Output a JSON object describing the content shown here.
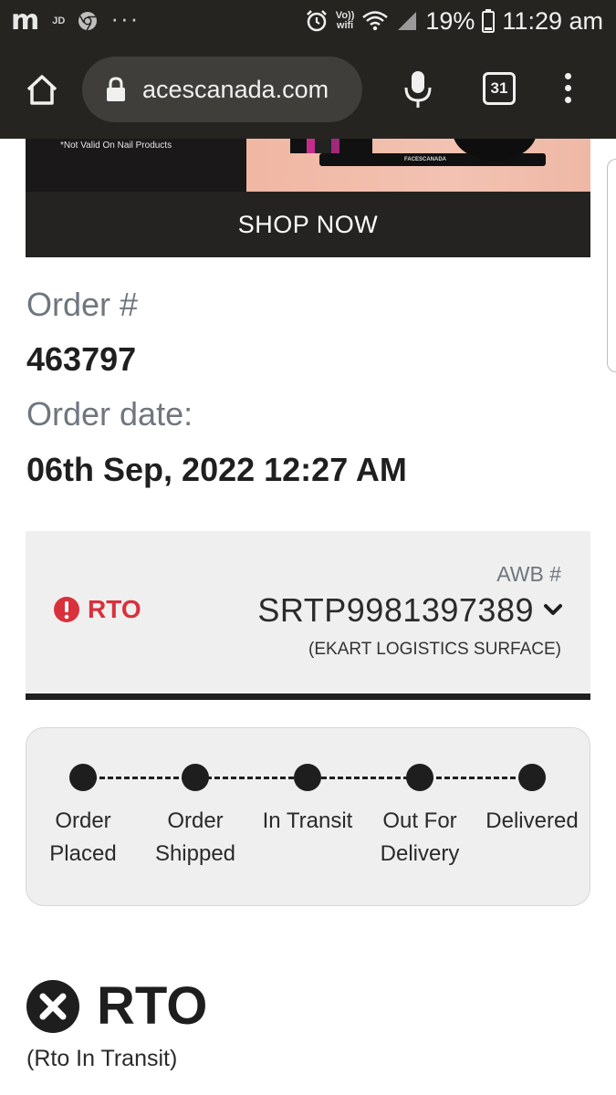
{
  "status_bar": {
    "carrier_left": "JD",
    "volte_top": "Vo))",
    "volte_bottom": "wifi",
    "battery": "19%",
    "time": "11:29 am",
    "icons": [
      "m-icon",
      "chrome-icon",
      "more-dots-icon",
      "alarm-icon",
      "wifi-icon",
      "signal-icon",
      "battery-icon"
    ]
  },
  "browser": {
    "url": "acescanada.com",
    "tab_count": "31",
    "icons": [
      "home-icon",
      "lock-icon",
      "mic-icon",
      "tabs-icon",
      "menu-icon"
    ]
  },
  "banner": {
    "note": "*Not Valid On Nail Products",
    "brand": "FACESCANADA",
    "cta": "SHOP NOW"
  },
  "order": {
    "number_label": "Order #",
    "number": "463797",
    "date_label": "Order date:",
    "date": "06th Sep, 2022 12:27 AM"
  },
  "shipment": {
    "status": "RTO",
    "status_color": "#d9303b",
    "awb_label": "AWB #",
    "awb_number": "SRTP9981397389",
    "carrier": "(EKART LOGISTICS SURFACE)"
  },
  "tracker": {
    "steps": [
      {
        "label": "Order\nPlaced"
      },
      {
        "label": "Order\nShipped"
      },
      {
        "label": "In Transit"
      },
      {
        "label": "Out For\nDelivery"
      },
      {
        "label": "Delivered"
      }
    ]
  },
  "rto_section": {
    "title": "RTO",
    "subtitle": "(Rto In Transit)"
  }
}
